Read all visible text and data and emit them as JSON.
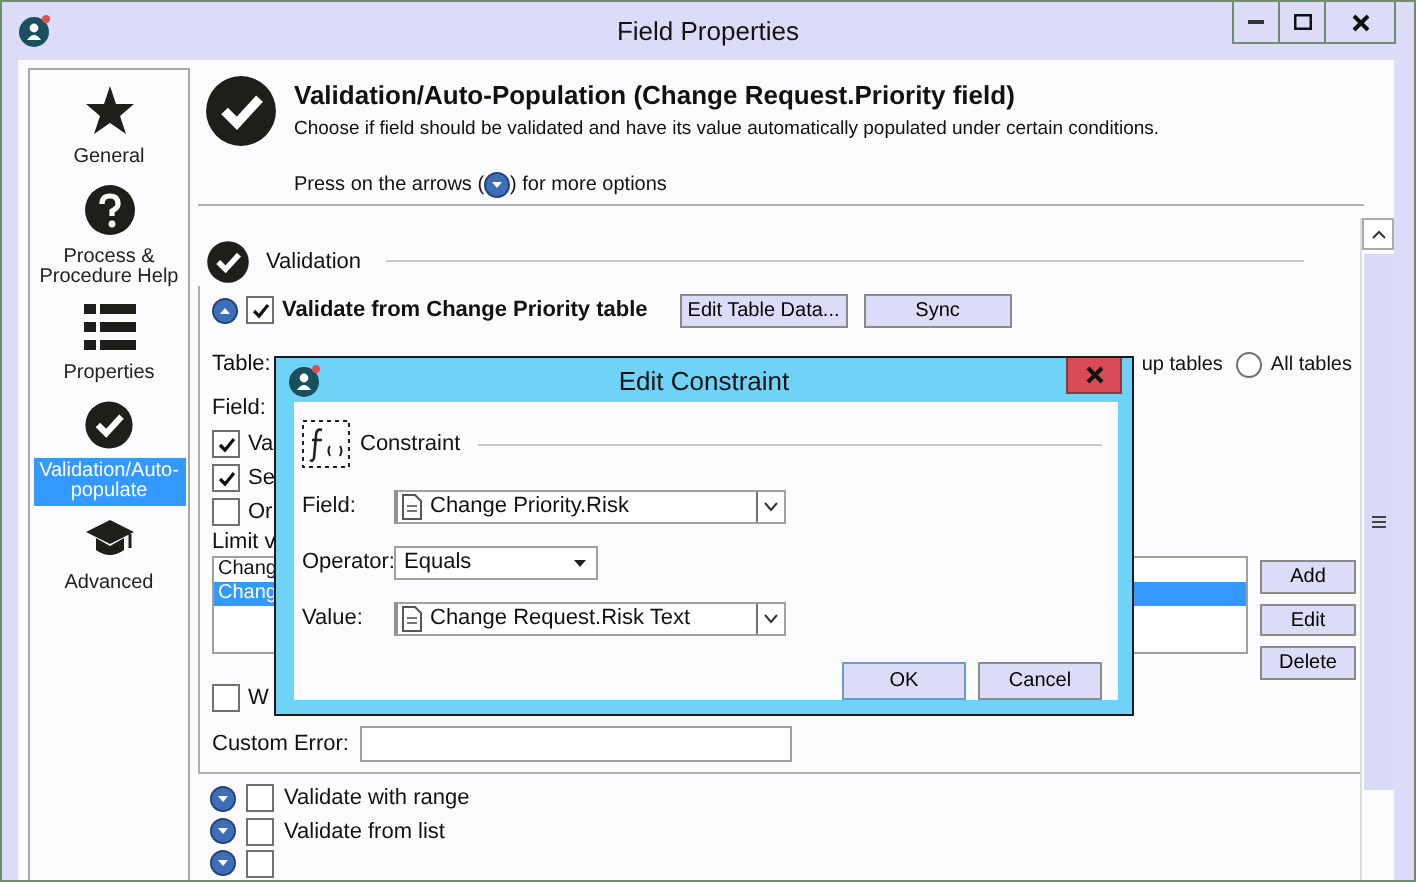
{
  "window": {
    "title": "Field Properties"
  },
  "sidebar": {
    "items": [
      {
        "kind": "star",
        "label": "General",
        "selected": false
      },
      {
        "kind": "help",
        "label": "Process & Procedure Help",
        "selected": false
      },
      {
        "kind": "list",
        "label": "Properties",
        "selected": false
      },
      {
        "kind": "check",
        "label": "Validation/Auto-populate",
        "selected": true
      },
      {
        "kind": "cap",
        "label": "Advanced",
        "selected": false
      }
    ]
  },
  "header": {
    "title": "Validation/Auto-Population (Change Request.Priority field)",
    "description": "Choose if field should be validated and have its value automatically populated under certain conditions.",
    "hint_before": "Press on the arrows (",
    "hint_after": ") for more options"
  },
  "section": {
    "title": "Validation"
  },
  "table_validation": {
    "expanded": true,
    "checked": true,
    "label": "Validate from Change Priority table",
    "buttons": [
      "Edit Table Data...",
      "Sync"
    ],
    "table_label": "Table:",
    "field_label": "Field:",
    "lookup_label": "up tables",
    "radio_options": [
      {
        "label": "All tables",
        "selected": false
      }
    ],
    "checkbox_options": [
      {
        "label": "Va",
        "checked": true
      },
      {
        "label": "Se",
        "checked": true
      },
      {
        "label": "Or",
        "checked": false
      }
    ],
    "limit_label": "Limit v",
    "list_items": [
      {
        "label": "Chang",
        "selected": false
      },
      {
        "label": "Chang",
        "selected": true
      }
    ],
    "list_buttons": [
      "Add",
      "Edit",
      "Delete"
    ],
    "after_option": {
      "label": "W",
      "checked": false
    },
    "custom_error_label": "Custom Error:"
  },
  "other_validations": [
    {
      "label": "Validate with range",
      "checked": false,
      "expanded": false
    },
    {
      "label": "Validate from list",
      "checked": false,
      "expanded": false
    },
    {
      "checked": false,
      "expanded": false
    }
  ],
  "dialog": {
    "title": "Edit Constraint",
    "group": "Constraint",
    "fields": [
      {
        "kind": "combo",
        "label": "Field:",
        "value": "Change Priority.Risk"
      },
      {
        "kind": "select",
        "label": "Operator:",
        "value": "Equals"
      },
      {
        "kind": "combo",
        "label": "Value:",
        "value": "Change Request.Risk Text"
      }
    ],
    "buttons": [
      "OK",
      "Cancel"
    ]
  }
}
